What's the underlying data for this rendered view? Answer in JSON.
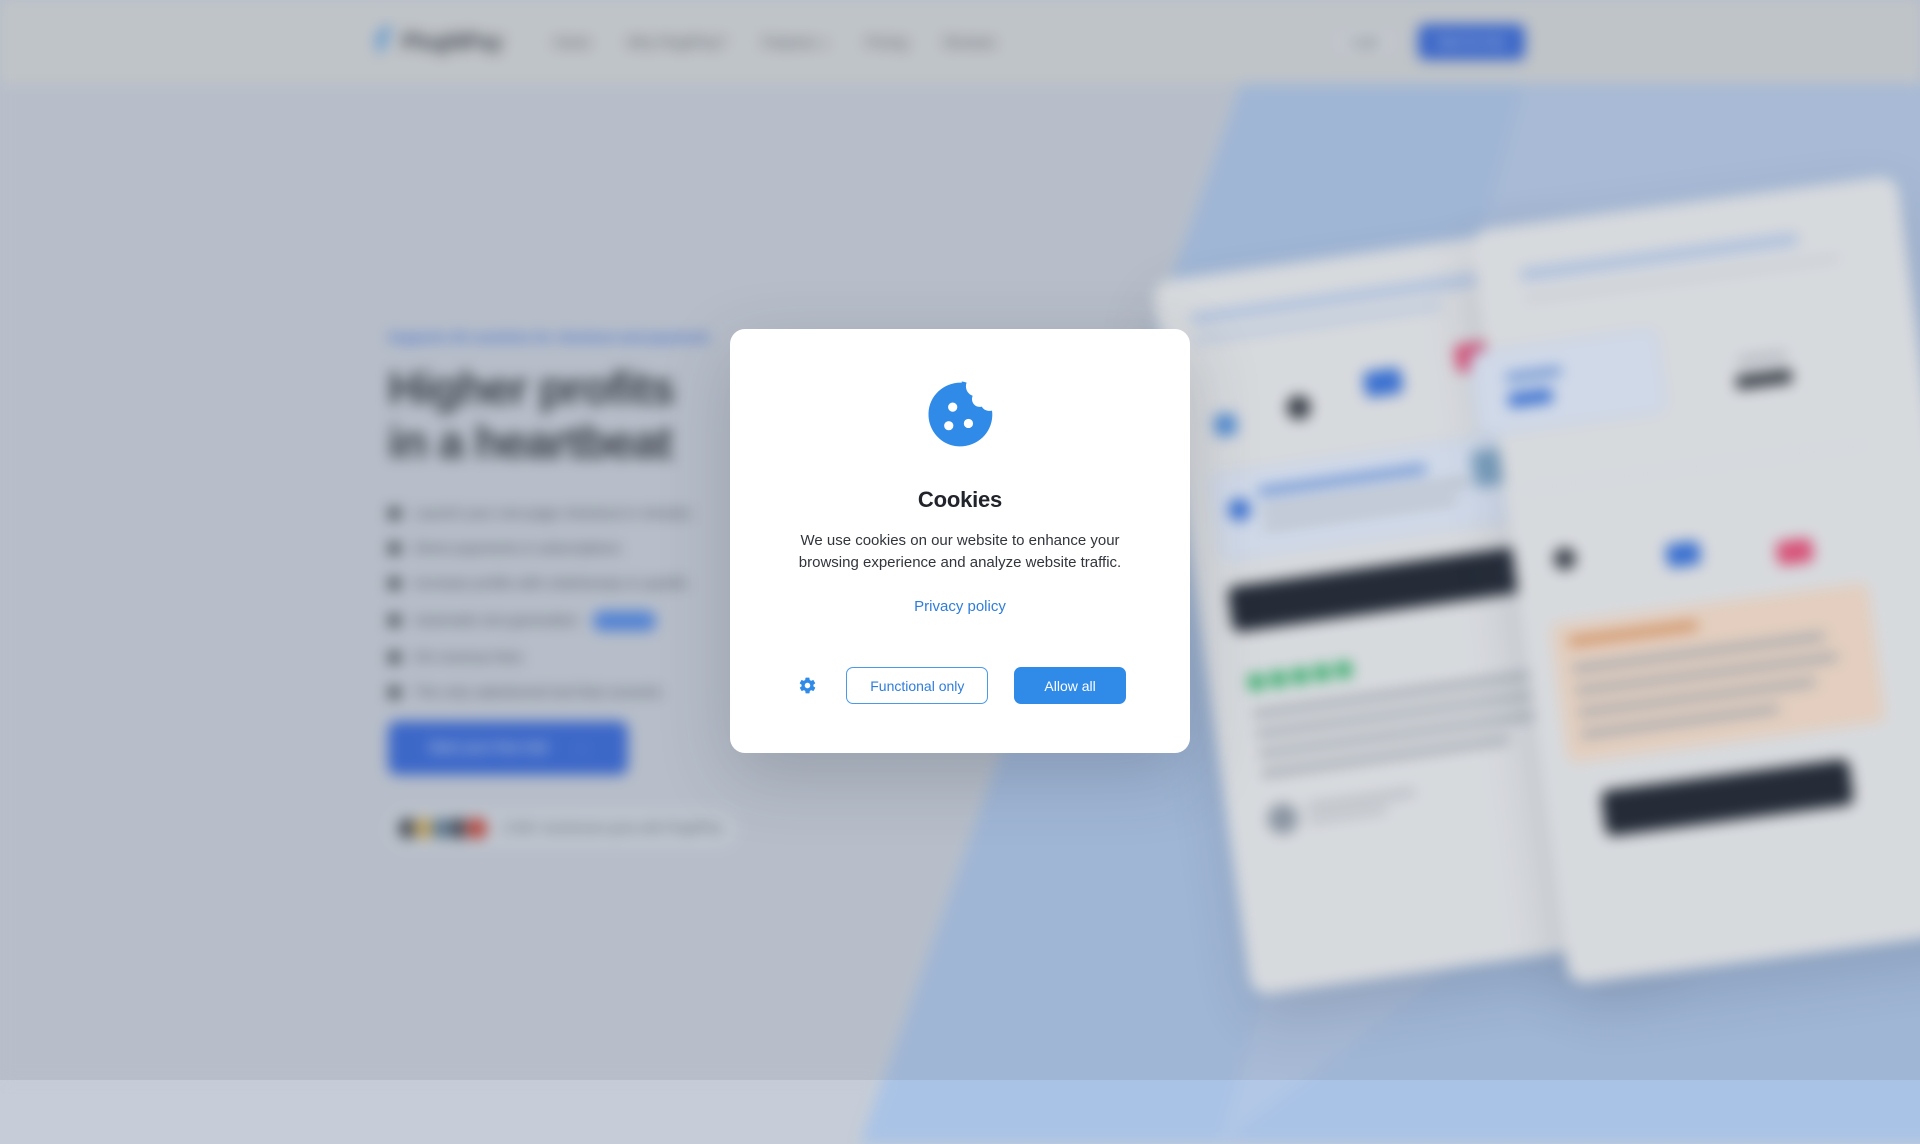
{
  "header": {
    "logo_text": "PlugNPay",
    "logo_icon": "lightning-bolt-icon",
    "nav": [
      {
        "label": "Home",
        "has_caret": false
      },
      {
        "label": "Why PlugNPay?",
        "has_caret": false
      },
      {
        "label": "Features",
        "has_caret": true
      },
      {
        "label": "Pricing",
        "has_caret": false
      },
      {
        "label": "Reviews",
        "has_caret": false
      }
    ],
    "login_label": "Login",
    "start_free_label": "Start for free"
  },
  "hero": {
    "eyebrow": "Supports 45 countries for checkout and payments",
    "heading_line1": "Higher profits",
    "heading_line2": "in a heartbeat",
    "bullets": [
      {
        "text": "Launch your one-page checkout in minutes",
        "highlight": ""
      },
      {
        "text": "Direct payments & subscriptions",
        "highlight": ""
      },
      {
        "text": "Increase profits with orderbumps & upsells",
        "highlight": ""
      },
      {
        "text": "Automatic text generation",
        "highlight": "with AI"
      },
      {
        "text": "0% revenue fees",
        "highlight": ""
      },
      {
        "text": "The only salesfunnel tool that converts",
        "highlight": ""
      }
    ],
    "cta_label": "Start your free trial",
    "cta_arrow": "→",
    "social_proof": "2.500+ businesses grow with PlugNPay",
    "avatar_colors": [
      "#3a3f46",
      "#c8a24a",
      "#4c6f8c",
      "#2f3642",
      "#c0392b"
    ]
  },
  "mockups": {
    "card_a_label": "checkout-preview-card",
    "card_b_label": "payment-settings-card",
    "dark_button_label": "Buy now",
    "star_count": 5
  },
  "modal": {
    "icon": "cookie-icon",
    "title": "Cookies",
    "body": "We use cookies on our website to enhance your browsing experience and analyze website traffic.",
    "privacy_link": "Privacy policy",
    "settings_icon": "gear-icon",
    "functional_label": "Functional only",
    "allow_label": "Allow all"
  },
  "colors": {
    "accent_blue": "#2f8ae8",
    "brand_blue": "#2f63d6",
    "link_blue": "#2f7ddb",
    "cookie_blue": "#2f8ae8",
    "page_bg": "#c5ccd7",
    "panel_blue": "#a9c3e6",
    "modal_bg": "#ffffff"
  }
}
